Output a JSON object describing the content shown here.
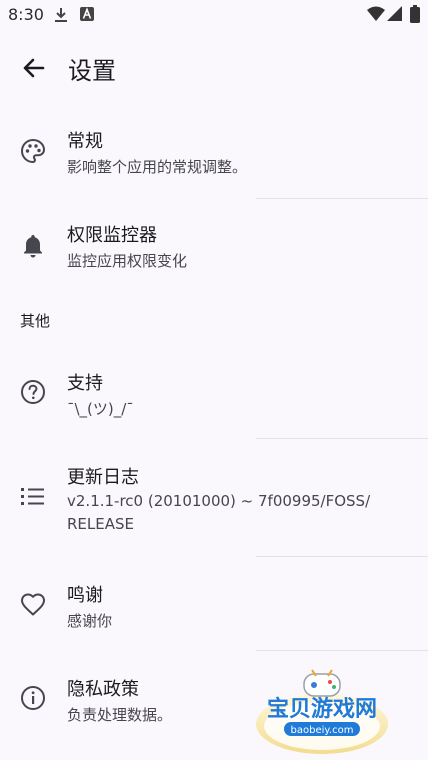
{
  "status_bar": {
    "time": "8:30"
  },
  "app_bar": {
    "title": "设置"
  },
  "items": [
    {
      "title": "常规",
      "summary": "影响整个应用的常规调整。"
    },
    {
      "title": "权限监控器",
      "summary": "监控应用权限变化"
    },
    {
      "title": "支持",
      "summary": "¯\\_(ツ)_/¯"
    },
    {
      "title": "更新日志",
      "summary": "v2.1.1-rc0 (20101000) ~ 7f00995/FOSS/\nRELEASE"
    },
    {
      "title": "鸣谢",
      "summary": "感谢你"
    },
    {
      "title": "隐私政策",
      "summary": "负责处理数据。"
    }
  ],
  "section": {
    "other": "其他"
  },
  "watermark": {
    "text": "宝贝游戏网",
    "url": "baobeiy.com"
  },
  "icons": [
    "download-icon",
    "a-badge-icon",
    "wifi-icon",
    "signal-icon",
    "battery-icon",
    "back-arrow-icon",
    "palette-icon",
    "bell-icon",
    "help-circle-icon",
    "list-icon",
    "heart-icon",
    "info-icon"
  ]
}
